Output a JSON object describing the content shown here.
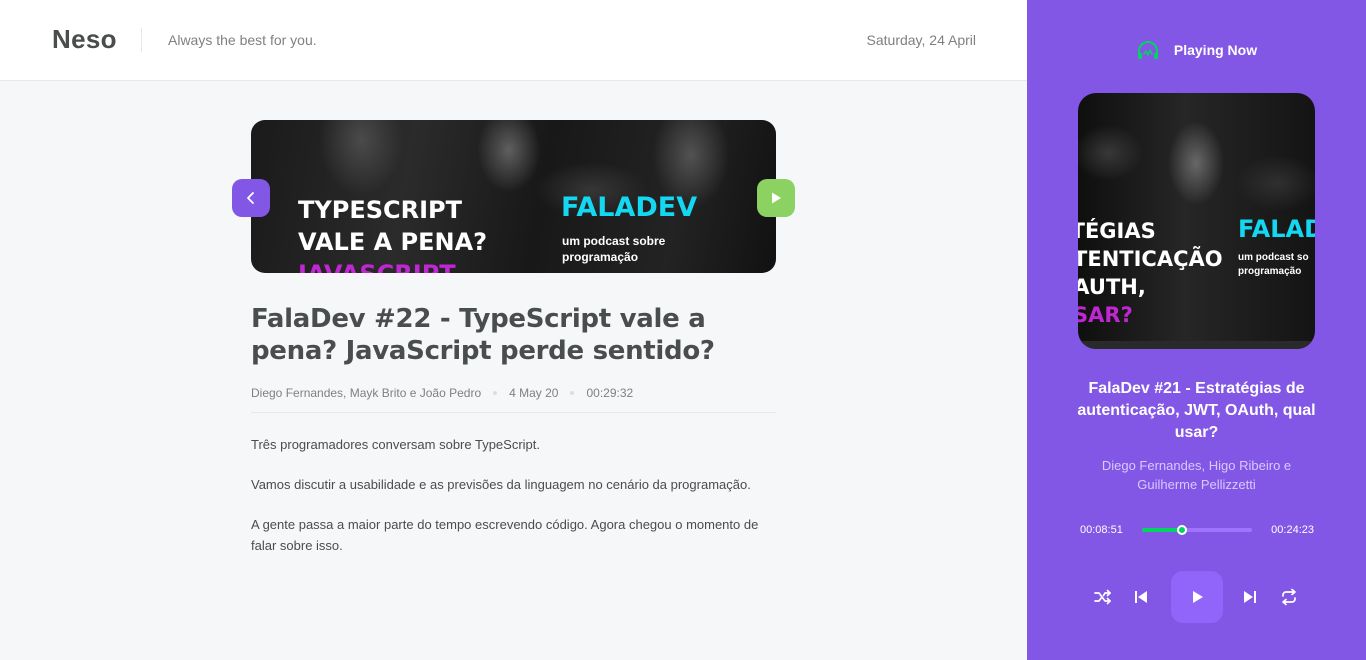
{
  "header": {
    "logo": "Neso",
    "tagline": "Always the best for you.",
    "date": "Saturday, 24 April"
  },
  "episode": {
    "thumbnail": {
      "line1": "TYPESCRIPT",
      "line2": "VALE A PENA?",
      "line3": "JAVASCRIPT",
      "brand": "FALADEV",
      "sub": "um podcast sobre programação"
    },
    "title": "FalaDev #22 - TypeScript vale a pena? JavaScript perde sentido?",
    "members": "Diego Fernandes, Mayk Brito e João Pedro",
    "published": "4 May 20",
    "duration": "00:29:32",
    "description": [
      "Três programadores conversam sobre TypeScript.",
      "Vamos discutir a usabilidade e as previsões da linguagem no cenário da programação.",
      "A gente passa a maior parte do tempo escrevendo código. Agora chegou o momento de falar sobre isso."
    ]
  },
  "player": {
    "heading": "Playing Now",
    "cover": {
      "line1": "ATÉGIAS",
      "line2": "UTENTICAÇÃO",
      "line3": "OAUTH,",
      "line4": "USAR?",
      "brand": "FALAD",
      "sub": "um podcast so programação"
    },
    "title": "FalaDev #21 - Estratégias de autenticação, JWT, OAuth, qual usar?",
    "members": "Diego Fernandes, Higo Ribeiro e Guilherme Pellizzetti",
    "current_time": "00:08:51",
    "total_time": "00:24:23",
    "progress": 0.36
  },
  "colors": {
    "purple": "#8257e5",
    "green": "#04d361",
    "play_green": "#8bd263",
    "cyan": "#14d8f2",
    "magenta": "#c026d3"
  },
  "icons": {
    "prev": "chevron-left-icon",
    "play": "play-icon",
    "headphones": "headphones-icon",
    "shuffle": "shuffle-icon",
    "previous": "skip-previous-icon",
    "next": "skip-next-icon",
    "repeat": "repeat-icon"
  }
}
